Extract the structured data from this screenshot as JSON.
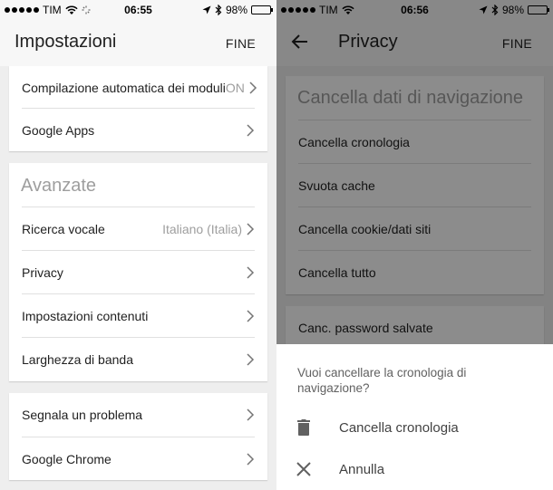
{
  "left": {
    "status": {
      "carrier": "TIM",
      "time": "06:55",
      "battery": "98%",
      "battery_level": 0.98
    },
    "appbar": {
      "title": "Impostazioni",
      "done": "FINE"
    },
    "card1": {
      "rows": [
        {
          "label": "Compilazione automatica dei moduli",
          "value": "ON"
        },
        {
          "label": "Google Apps",
          "value": ""
        }
      ]
    },
    "card2": {
      "section": "Avanzate",
      "rows": [
        {
          "label": "Ricerca vocale",
          "value": "Italiano (Italia)"
        },
        {
          "label": "Privacy",
          "value": ""
        },
        {
          "label": "Impostazioni contenuti",
          "value": ""
        },
        {
          "label": "Larghezza di banda",
          "value": ""
        }
      ]
    },
    "card3": {
      "rows": [
        {
          "label": "Segnala un problema",
          "value": ""
        },
        {
          "label": "Google Chrome",
          "value": ""
        }
      ]
    }
  },
  "right": {
    "status": {
      "carrier": "TIM",
      "time": "06:56",
      "battery": "98%",
      "battery_level": 0.98
    },
    "appbar": {
      "title": "Privacy",
      "done": "FINE"
    },
    "card1": {
      "section": "Cancella dati di navigazione",
      "rows": [
        {
          "label": "Cancella cronologia"
        },
        {
          "label": "Svuota cache"
        },
        {
          "label": "Cancella cookie/dati siti"
        },
        {
          "label": "Cancella tutto"
        }
      ]
    },
    "card2": {
      "rows": [
        {
          "label": "Canc. password salvate"
        }
      ]
    },
    "sheet": {
      "question": "Vuoi cancellare la cronologia di navigazione?",
      "confirm": "Cancella cronologia",
      "cancel": "Annulla"
    }
  },
  "icons": {
    "signal": "signal-dots-icon",
    "wifi": "wifi-icon",
    "location": "location-arrow-icon",
    "bluetooth": "bluetooth-icon",
    "battery": "battery-icon",
    "chevron": "chevron-right-icon",
    "back": "back-arrow-icon",
    "trash": "trash-icon",
    "close": "close-icon"
  },
  "colors": {
    "bar": "#f7f7f7",
    "background": "#eeeeee",
    "card": "#ffffff",
    "muted": "#9e9e9e",
    "scrim": "#000000"
  }
}
